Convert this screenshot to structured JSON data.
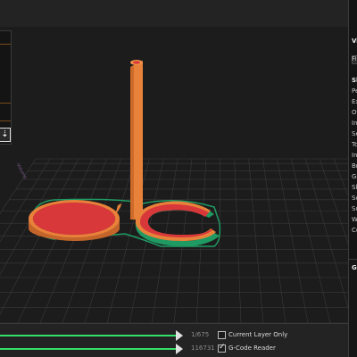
{
  "viewport": {
    "colors": {
      "background": "#1c1c1c",
      "grid": "#3a3a3a",
      "infill": "#d8383a",
      "perimeter": "#e8823a",
      "skirt": "#1f9a63"
    },
    "axis_label": "-Volume"
  },
  "left_panel": {
    "download_icon": "download-arrow-icon"
  },
  "right_panel": {
    "fragments": [
      "Vi",
      "Fi",
      "Sk",
      "Pe",
      "Ex",
      "Of",
      "In",
      "Se",
      "To",
      "In",
      "Br",
      "Ga",
      "Sk",
      "Se",
      "Su",
      "We",
      "Ce",
      "G"
    ]
  },
  "bottom_bar": {
    "layer_counter": "1/675",
    "move_counter": "116731",
    "current_layer_only_label": "Current Layer Only",
    "current_layer_only_checked": false,
    "gcode_reader_label": "G-Code Reader",
    "gcode_reader_checked": true,
    "slider_color": "#35e06a"
  }
}
